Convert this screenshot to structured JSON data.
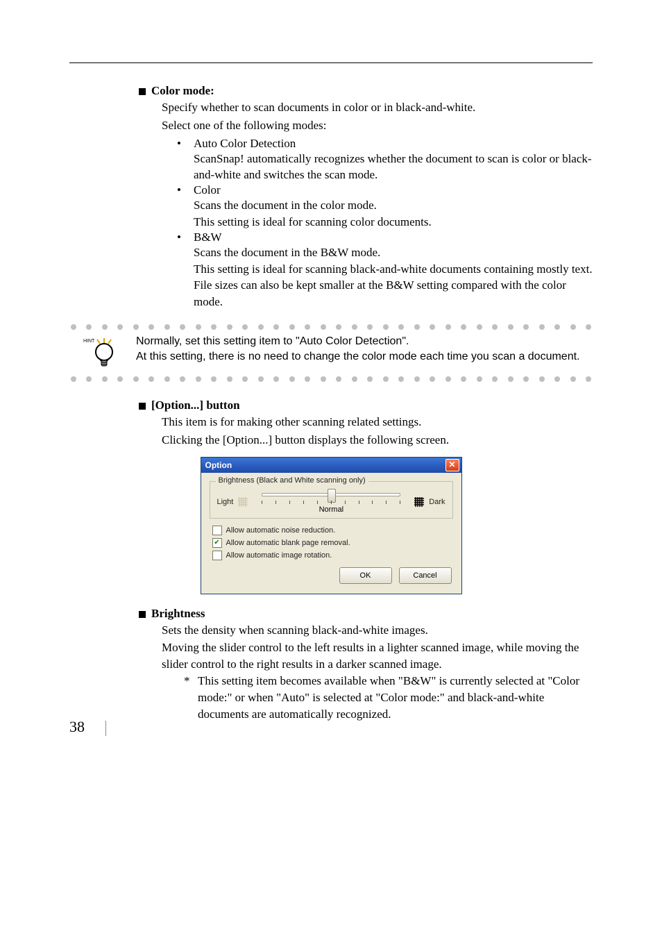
{
  "page_number": "38",
  "sections": {
    "color_mode": {
      "heading": "Color mode:",
      "intro1": "Specify whether to scan documents in color or in black-and-white.",
      "intro2": "Select one of the following modes:",
      "items": [
        {
          "label": "Auto Color Detection",
          "desc": "ScanSnap! automatically recognizes whether the document to scan is color or black-and-white and switches the scan mode."
        },
        {
          "label": "Color",
          "desc1": "Scans the document in the color mode.",
          "desc2": "This setting is ideal for scanning color documents."
        },
        {
          "label": "B&W",
          "desc1": "Scans the document in the B&W mode.",
          "desc2": "This setting is ideal for scanning black-and-white documents containing mostly text.  File sizes can also be kept smaller at the B&W setting compared with the color mode."
        }
      ]
    },
    "hint": {
      "label": "HINT",
      "line1": "Normally, set this setting item to \"Auto Color Detection\".",
      "line2": "At this setting, there is no need to change the color mode each time you scan a document."
    },
    "option_button": {
      "heading": "[Option...] button",
      "line1": "This item is for making other scanning related settings.",
      "line2": "Clicking the [Option...] button displays the following screen."
    },
    "dialog": {
      "title": "Option",
      "group_label": "Brightness (Black and White scanning only)",
      "light": "Light",
      "dark": "Dark",
      "normal": "Normal",
      "checks": [
        {
          "label": "Allow automatic noise reduction.",
          "checked": false
        },
        {
          "label": "Allow automatic blank page removal.",
          "checked": true
        },
        {
          "label": "Allow automatic image rotation.",
          "checked": false
        }
      ],
      "ok": "OK",
      "cancel": "Cancel"
    },
    "brightness": {
      "heading": "Brightness",
      "line1": "Sets the density when scanning black-and-white images.",
      "line2": "Moving the slider control to the left results in a lighter scanned image, while moving the slider control to the right results in a darker scanned image.",
      "note": "This setting item becomes available when \"B&W\" is currently selected at \"Color mode:\" or when \"Auto\" is selected at \"Color mode:\" and black-and-white documents are automatically recognized."
    }
  }
}
